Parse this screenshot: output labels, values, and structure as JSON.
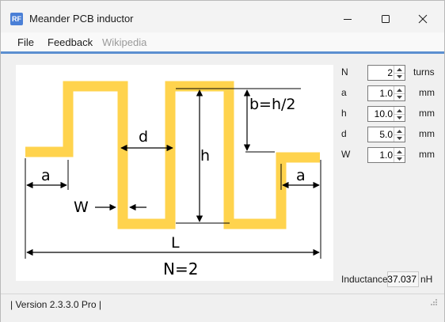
{
  "window": {
    "title": "Meander PCB inductor",
    "icon_text": "RF",
    "controls": [
      "minimize-icon",
      "maximize-icon",
      "close-icon"
    ]
  },
  "menu": {
    "file": "File",
    "feedback": "Feedback",
    "wikipedia": "Wikipedia"
  },
  "diagram": {
    "label_b": "b=h/2",
    "label_d": "d",
    "label_h": "h",
    "label_a_left": "a",
    "label_a_right": "a",
    "label_W": "W",
    "label_L": "L",
    "label_N": "N=2",
    "trace_color": "#ffd34d"
  },
  "params": [
    {
      "label": "N",
      "value": "2",
      "unit": "turns"
    },
    {
      "label": "a",
      "value": "1.0",
      "unit": "mm"
    },
    {
      "label": "h",
      "value": "10.0",
      "unit": "mm"
    },
    {
      "label": "d",
      "value": "5.0",
      "unit": "mm"
    },
    {
      "label": "W",
      "value": "1.0",
      "unit": "mm"
    }
  ],
  "result": {
    "label": "Inductance",
    "value": "37.037",
    "unit": "nH"
  },
  "status": {
    "text": "| Version 2.3.3.0 Pro |"
  }
}
